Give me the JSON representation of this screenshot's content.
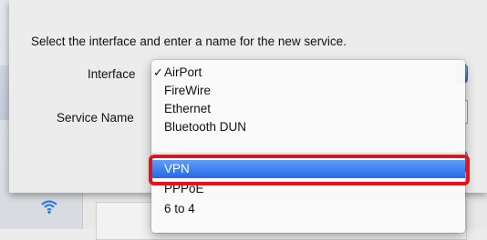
{
  "sheet": {
    "prompt": "Select the interface and enter a name for the new service.",
    "interface_label": "Interface",
    "service_name_label": "Service Name"
  },
  "menu": {
    "checkmark": "✓",
    "items": [
      {
        "label": "AirPort",
        "checked": true
      },
      {
        "label": "FireWire"
      },
      {
        "label": "Ethernet"
      },
      {
        "label": "Bluetooth DUN"
      },
      {
        "label": "VPN",
        "selected": true
      },
      {
        "label": "PPPoE"
      },
      {
        "label": "6 to 4"
      }
    ]
  },
  "colors": {
    "selection": "#2668e8",
    "annotation": "#e0141c"
  },
  "icons": [
    "checkmark-icon",
    "wifi-icon",
    "network-icon"
  ]
}
